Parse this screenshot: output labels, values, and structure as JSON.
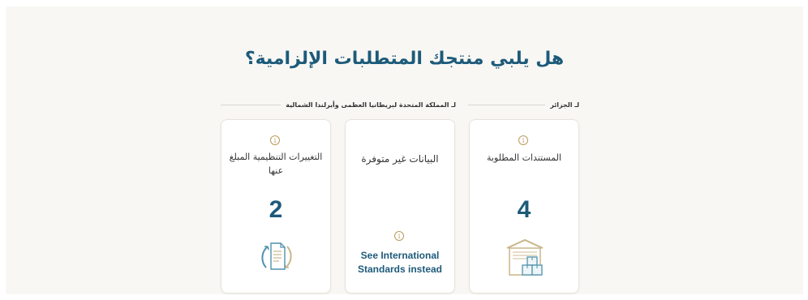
{
  "heading": "هل يلبي منتجك المتطلبات الإلزامية؟",
  "countries": {
    "algeria": "لـ الجزائر",
    "uk": "لـ المملكة المتحدة لبريطانيا العظمى وأيرلندا الشمالية"
  },
  "cards": {
    "documents": {
      "label": "المستندات المطلوبة",
      "value": "4",
      "icon": "info-icon"
    },
    "unavailable": {
      "label": "البيانات غير متوفرة",
      "link": "See International Standards instead",
      "icon": "info-icon"
    },
    "regulatory": {
      "label": "التغييرات التنظيمية المبلغ عنها",
      "value": "2",
      "icon": "info-icon"
    }
  },
  "colors": {
    "accent": "#1d5a7a",
    "gold": "#b99b5b",
    "background": "#f8f7f4"
  }
}
